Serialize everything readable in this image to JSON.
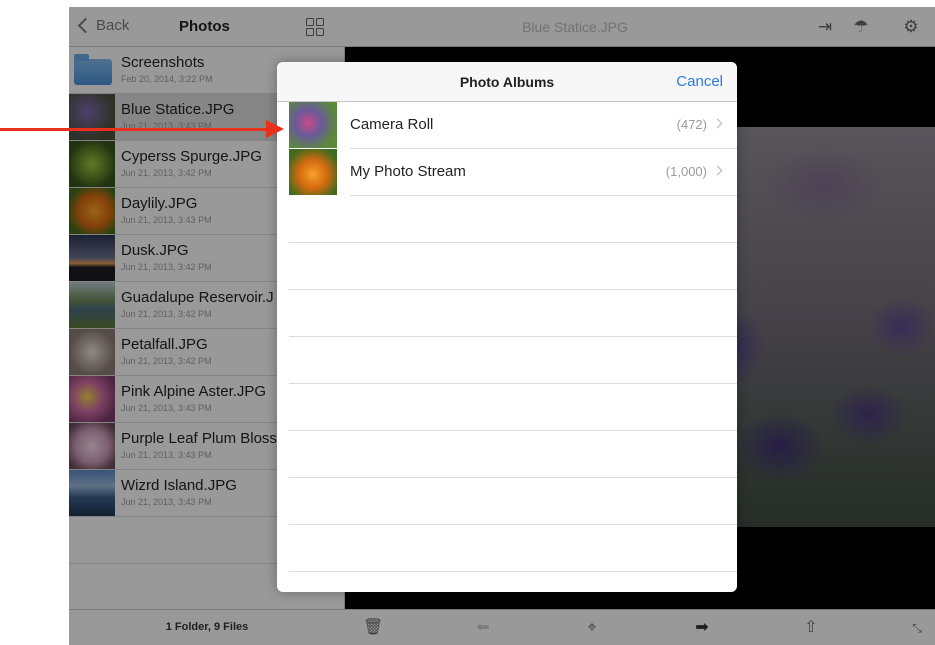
{
  "sidebar": {
    "back_label": "Back",
    "title": "Photos",
    "items": [
      {
        "name": "Screenshots",
        "date": "Feb 20, 2014, 3:22 PM"
      },
      {
        "name": "Blue Statice.JPG",
        "date": "Jun 21, 2013, 3:43 PM"
      },
      {
        "name": "Cyperss Spurge.JPG",
        "date": "Jun 21, 2013, 3:42 PM"
      },
      {
        "name": "Daylily.JPG",
        "date": "Jun 21, 2013, 3:43 PM"
      },
      {
        "name": "Dusk.JPG",
        "date": "Jun 21, 2013, 3:42 PM"
      },
      {
        "name": "Guadalupe Reservoir.J",
        "date": "Jun 21, 2013, 3:42 PM"
      },
      {
        "name": "Petalfall.JPG",
        "date": "Jun 21, 2013, 3:42 PM"
      },
      {
        "name": "Pink Alpine Aster.JPG",
        "date": "Jun 21, 2013, 3:43 PM"
      },
      {
        "name": "Purple Leaf Plum Bloss",
        "date": "Jun 21, 2013, 3:43 PM"
      },
      {
        "name": "Wizrd Island.JPG",
        "date": "Jun 21, 2013, 3:43 PM"
      }
    ],
    "footer": "1 Folder, 9 Files"
  },
  "viewer": {
    "title": "Blue Statice.JPG"
  },
  "modal": {
    "title": "Photo Albums",
    "cancel_label": "Cancel",
    "albums": [
      {
        "name": "Camera Roll",
        "count": "(472)"
      },
      {
        "name": "My Photo Stream",
        "count": "(1,000)"
      }
    ]
  },
  "colors": {
    "accent": "#2a7ae2",
    "annotation_arrow": "#e8301b"
  }
}
